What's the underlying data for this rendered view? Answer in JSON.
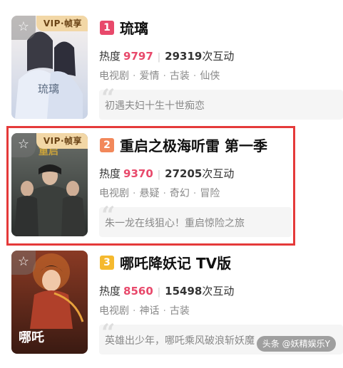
{
  "items": [
    {
      "rank": "1",
      "rank_color": "#e8496b",
      "title": "琉璃",
      "heat_label": "热度",
      "heat_value": "9797",
      "interaction_value": "29319",
      "interaction_label": "次互动",
      "tags": [
        "电视剧",
        "爱情",
        "古装",
        "仙侠"
      ],
      "quote": "初遇夫妇十生十世痴恋",
      "vip_label": "VIP·帧享",
      "poster_title": "琉璃"
    },
    {
      "rank": "2",
      "rank_color": "#f2885a",
      "title": "重启之极海听雷 第一季",
      "heat_label": "热度",
      "heat_value": "9370",
      "interaction_value": "27205",
      "interaction_label": "次互动",
      "tags": [
        "电视剧",
        "悬疑",
        "奇幻",
        "冒险"
      ],
      "quote": "朱一龙在线狙心！重启惊险之旅",
      "vip_label": "VIP·帧享",
      "poster_title": "重启"
    },
    {
      "rank": "3",
      "rank_color": "#f5b92e",
      "title": "哪吒降妖记 TV版",
      "heat_label": "热度",
      "heat_value": "8560",
      "interaction_value": "15498",
      "interaction_label": "次互动",
      "tags": [
        "电视剧",
        "神话",
        "古装"
      ],
      "quote": "英雄出少年，哪吒乘风破浪斩妖魔",
      "poster_title": "哪吒"
    }
  ],
  "icons": {
    "favorite": "star-icon",
    "quote": "quote-icon"
  },
  "watermark": "头条 @妖精娱乐Y"
}
